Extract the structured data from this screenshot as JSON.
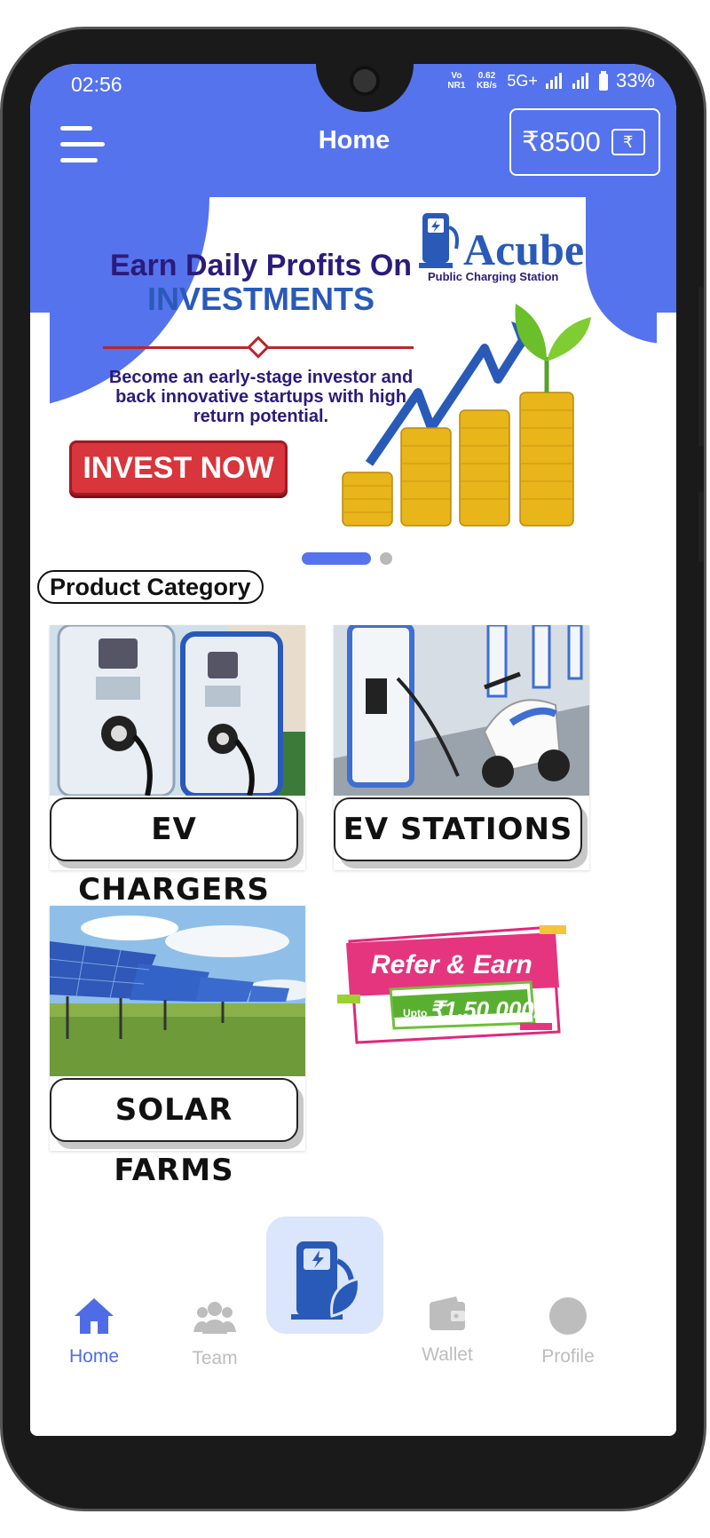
{
  "status_bar": {
    "time": "02:56",
    "volte": "Vo NR1",
    "speed": "0.62 KB/s",
    "network": "5G+",
    "battery": "33%"
  },
  "header": {
    "title": "Home",
    "wallet_balance": "₹8500",
    "wallet_icon_glyph": "₹"
  },
  "banner": {
    "headline_line1": "Earn Daily Profits On",
    "headline_line2": "INVESTMENTS",
    "subcopy_line1": "Become an early-stage investor and",
    "subcopy_line2": "back innovative startups with high",
    "subcopy_line3": "return potential.",
    "cta_label": "INVEST NOW",
    "brand_name": "Acube",
    "brand_tagline": "Public Charging Station",
    "slides_total": 2,
    "active_slide": 1
  },
  "category_section": {
    "title": "Product Category",
    "cards": [
      {
        "label": "EV CHARGERS"
      },
      {
        "label": "EV STATIONS"
      },
      {
        "label": "SOLAR FARMS"
      }
    ]
  },
  "promo": {
    "title": "Refer & Earn",
    "upto": "Upto",
    "amount": "₹1,50,000/-"
  },
  "bottom_nav": {
    "items": [
      {
        "label": "Home",
        "icon": "home-icon"
      },
      {
        "label": "Team",
        "icon": "team-icon"
      },
      {
        "label": "Wallet",
        "icon": "wallet-icon"
      },
      {
        "label": "Profile",
        "icon": "profile-icon"
      }
    ],
    "center_icon": "charging-station-icon"
  },
  "colors": {
    "primary": "#5573ed",
    "nav_active": "#4f6ce6",
    "nav_inactive": "#bdbdbd",
    "cta_red": "#d8353c"
  }
}
